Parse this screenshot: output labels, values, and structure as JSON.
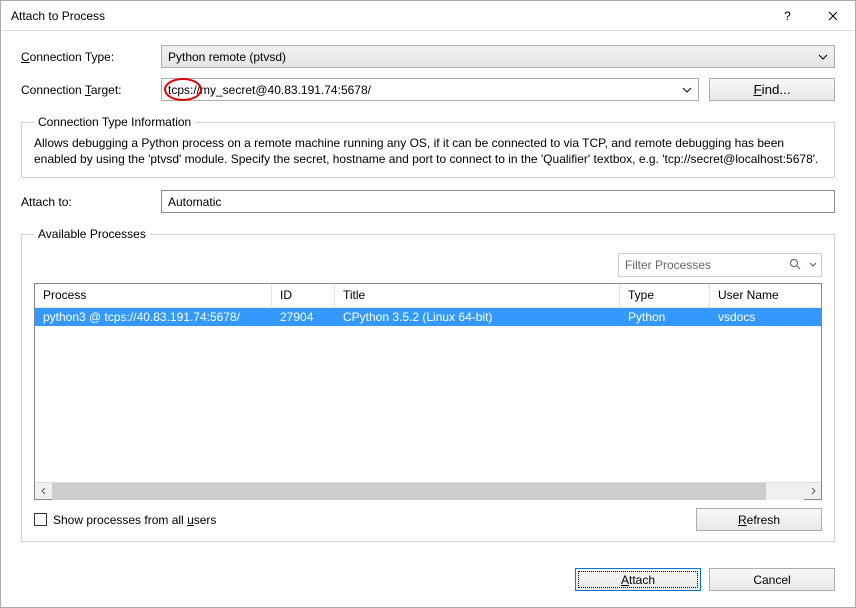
{
  "window": {
    "title": "Attach to Process"
  },
  "labels": {
    "connection_type": "Connection Type:",
    "connection_target": "Connection Target:",
    "attach_to": "Attach to:",
    "conn_type_info_legend": "Connection Type Information",
    "available_processes_legend": "Available Processes"
  },
  "values": {
    "connection_type": "Python remote (ptvsd)",
    "connection_target": "tcps://my_secret@40.83.191.74:5678/",
    "attach_to": "Automatic",
    "filter_placeholder": "Filter Processes"
  },
  "buttons": {
    "find": "Find...",
    "refresh": "Refresh",
    "attach": "Attach",
    "cancel": "Cancel"
  },
  "info_text": "Allows debugging a Python process on a remote machine running any OS, if it can be connected to via TCP, and remote debugging has been enabled by using the 'ptvsd' module. Specify the secret, hostname and port to connect to in the 'Qualifier' textbox, e.g. 'tcp://secret@localhost:5678'.",
  "table": {
    "headers": {
      "process": "Process",
      "id": "ID",
      "title": "Title",
      "type": "Type",
      "user": "User Name"
    },
    "rows": [
      {
        "process": "python3 @ tcps://40.83.191.74:5678/",
        "id": "27904",
        "title": "CPython 3.5.2 (Linux 64-bit)",
        "type": "Python",
        "user": "vsdocs"
      }
    ]
  },
  "checkbox": {
    "show_all_users": "Show processes from all users"
  },
  "accel": {
    "conn_type_u": "C",
    "conn_type_rest": "onnection Type:",
    "conn_target_pre": "Connection ",
    "conn_target_u": "T",
    "conn_target_rest": "arget:",
    "find_u": "F",
    "find_rest": "ind...",
    "show_pre": "Show processes from all ",
    "show_u": "u",
    "show_rest": "sers",
    "refresh_u": "R",
    "refresh_rest": "efresh",
    "attach_u": "A",
    "attach_rest": "ttach"
  }
}
